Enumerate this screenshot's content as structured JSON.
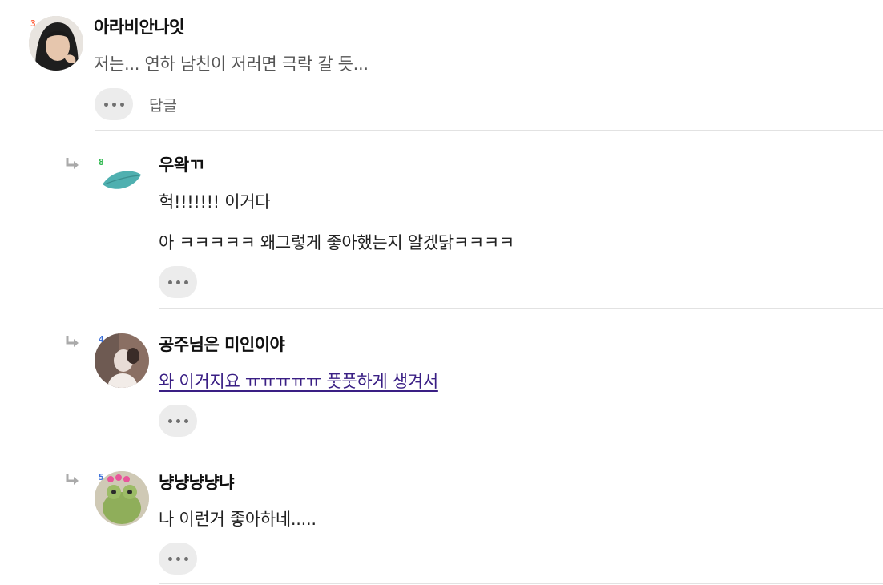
{
  "comments": [
    {
      "level_badge": "3",
      "badge_color": "#ff5e3a",
      "author": "아라비안나잇",
      "lines": [
        "저는... 연하 남친이 저러면 극락 갈 듯..."
      ],
      "reply_label": "답글",
      "avatar_icon": "avatar-photo-icon"
    }
  ],
  "replies": [
    {
      "level_badge": "8",
      "badge_color": "#2fb84f",
      "author": "우왁ㄲ",
      "lines": [
        "헉!!!!!!! 이거다",
        "아 ㅋㅋㅋㅋㅋ 왜그렇게 좋아했는지 알겠닭ㅋㅋㅋㅋ"
      ],
      "avatar_icon": "leaf-icon"
    },
    {
      "level_badge": "4",
      "badge_color": "#3b6fd8",
      "author": "공주님은 미인이야",
      "lines": [
        "와 이거지요 ㅠㅠㅠㅠㅠ 풋풋하게 생겨서"
      ],
      "avatar_icon": "avatar-photo-icon"
    },
    {
      "level_badge": "5",
      "badge_color": "#3b6fd8",
      "author": "냥냥냥냥냐",
      "lines": [
        "나 이런거 좋아하네....."
      ],
      "avatar_icon": "frog-avatar-icon"
    }
  ],
  "colors": {
    "link": "#3a1f84",
    "divider": "#e2e2e2",
    "button_bg": "#ececec"
  }
}
